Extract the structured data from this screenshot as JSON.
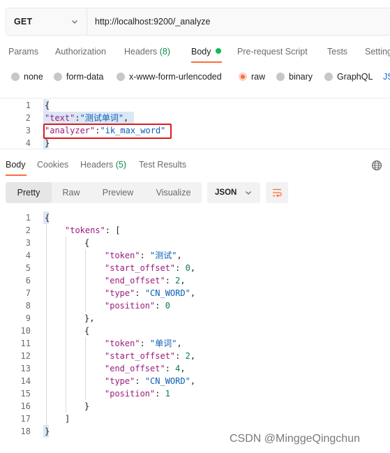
{
  "request": {
    "method": "GET",
    "url": "http://localhost:9200/_analyze"
  },
  "request_tabs": [
    {
      "label": "Params"
    },
    {
      "label": "Authorization"
    },
    {
      "label": "Headers",
      "count": "(8)"
    },
    {
      "label": "Body"
    },
    {
      "label": "Pre-request Script"
    },
    {
      "label": "Tests"
    },
    {
      "label": "Settings"
    }
  ],
  "body_types": [
    {
      "label": "none"
    },
    {
      "label": "form-data"
    },
    {
      "label": "x-www-form-urlencoded"
    },
    {
      "label": "raw"
    },
    {
      "label": "binary"
    },
    {
      "label": "GraphQL"
    },
    {
      "label": "JS"
    }
  ],
  "request_body": {
    "line_numbers": [
      "1",
      "2",
      "3",
      "4"
    ],
    "open_brace": "{",
    "close_brace": "}",
    "line2_key": "\"text\"",
    "line2_colon": ":",
    "line2_value": "\"测试单词\"",
    "line2_comma": ",",
    "line3_key": "\"analyzer\"",
    "line3_colon": ":",
    "line3_value": "\"ik_max_word\""
  },
  "response_tabs": [
    {
      "label": "Body"
    },
    {
      "label": "Cookies"
    },
    {
      "label": "Headers",
      "count": "(5)"
    },
    {
      "label": "Test Results"
    }
  ],
  "view_modes": [
    "Pretty",
    "Raw",
    "Preview",
    "Visualize"
  ],
  "format": "JSON",
  "response_body": {
    "line_numbers": [
      "1",
      "2",
      "3",
      "4",
      "5",
      "6",
      "7",
      "8",
      "9",
      "10",
      "11",
      "12",
      "13",
      "14",
      "15",
      "16",
      "17",
      "18"
    ],
    "open_brace": "{",
    "tokens_key": "\"tokens\"",
    "tokens_open": ": [",
    "t1_open": "{",
    "t1_token_key": "\"token\"",
    "t1_token_val": "\"测试\"",
    "t1_start_key": "\"start_offset\"",
    "t1_start_val": "0",
    "t1_end_key": "\"end_offset\"",
    "t1_end_val": "2",
    "t1_type_key": "\"type\"",
    "t1_type_val": "\"CN_WORD\"",
    "t1_pos_key": "\"position\"",
    "t1_pos_val": "0",
    "t1_close": "},",
    "t2_open": "{",
    "t2_token_key": "\"token\"",
    "t2_token_val": "\"单词\"",
    "t2_start_key": "\"start_offset\"",
    "t2_start_val": "2",
    "t2_end_key": "\"end_offset\"",
    "t2_end_val": "4",
    "t2_type_key": "\"type\"",
    "t2_type_val": "\"CN_WORD\"",
    "t2_pos_key": "\"position\"",
    "t2_pos_val": "1",
    "t2_close": "}",
    "tokens_close": "]",
    "close_brace": "}",
    "colon_sep": ": ",
    "comma": ","
  },
  "watermark": "CSDN @MinggeQingchun",
  "colors": {
    "accent": "#ff6c37",
    "active_dot": "#0cbb52",
    "highlight_box": "#e01a1a"
  }
}
